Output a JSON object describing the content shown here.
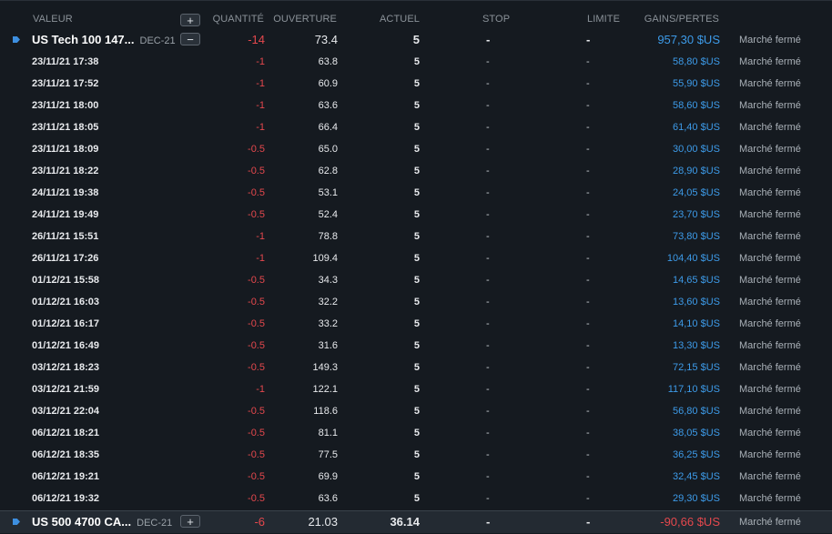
{
  "headers": {
    "valeur": "VALEUR",
    "quantite": "QUANTITÉ",
    "ouverture": "OUVERTURE",
    "actuel": "ACTUEL",
    "stop": "STOP",
    "limite": "LIMITE",
    "gains": "GAINS/PERTES",
    "add_symbol": "+"
  },
  "group1": {
    "name": "US Tech 100 147...",
    "expiry": "DEC-21",
    "toggle": "−",
    "qty": "-14",
    "open": "73.4",
    "current": "5",
    "stop": "-",
    "limit": "-",
    "pl": "957,30 $US",
    "status": "Marché fermé"
  },
  "positions": [
    {
      "date": "23/11/21 17:38",
      "qty": "-1",
      "open": "63.8",
      "current": "5",
      "stop": "-",
      "limit": "-",
      "pl": "58,80 $US",
      "status": "Marché fermé"
    },
    {
      "date": "23/11/21 17:52",
      "qty": "-1",
      "open": "60.9",
      "current": "5",
      "stop": "-",
      "limit": "-",
      "pl": "55,90 $US",
      "status": "Marché fermé"
    },
    {
      "date": "23/11/21 18:00",
      "qty": "-1",
      "open": "63.6",
      "current": "5",
      "stop": "-",
      "limit": "-",
      "pl": "58,60 $US",
      "status": "Marché fermé"
    },
    {
      "date": "23/11/21 18:05",
      "qty": "-1",
      "open": "66.4",
      "current": "5",
      "stop": "-",
      "limit": "-",
      "pl": "61,40 $US",
      "status": "Marché fermé"
    },
    {
      "date": "23/11/21 18:09",
      "qty": "-0.5",
      "open": "65.0",
      "current": "5",
      "stop": "-",
      "limit": "-",
      "pl": "30,00 $US",
      "status": "Marché fermé"
    },
    {
      "date": "23/11/21 18:22",
      "qty": "-0.5",
      "open": "62.8",
      "current": "5",
      "stop": "-",
      "limit": "-",
      "pl": "28,90 $US",
      "status": "Marché fermé"
    },
    {
      "date": "24/11/21 19:38",
      "qty": "-0.5",
      "open": "53.1",
      "current": "5",
      "stop": "-",
      "limit": "-",
      "pl": "24,05 $US",
      "status": "Marché fermé"
    },
    {
      "date": "24/11/21 19:49",
      "qty": "-0.5",
      "open": "52.4",
      "current": "5",
      "stop": "-",
      "limit": "-",
      "pl": "23,70 $US",
      "status": "Marché fermé"
    },
    {
      "date": "26/11/21 15:51",
      "qty": "-1",
      "open": "78.8",
      "current": "5",
      "stop": "-",
      "limit": "-",
      "pl": "73,80 $US",
      "status": "Marché fermé"
    },
    {
      "date": "26/11/21 17:26",
      "qty": "-1",
      "open": "109.4",
      "current": "5",
      "stop": "-",
      "limit": "-",
      "pl": "104,40 $US",
      "status": "Marché fermé"
    },
    {
      "date": "01/12/21 15:58",
      "qty": "-0.5",
      "open": "34.3",
      "current": "5",
      "stop": "-",
      "limit": "-",
      "pl": "14,65 $US",
      "status": "Marché fermé"
    },
    {
      "date": "01/12/21 16:03",
      "qty": "-0.5",
      "open": "32.2",
      "current": "5",
      "stop": "-",
      "limit": "-",
      "pl": "13,60 $US",
      "status": "Marché fermé"
    },
    {
      "date": "01/12/21 16:17",
      "qty": "-0.5",
      "open": "33.2",
      "current": "5",
      "stop": "-",
      "limit": "-",
      "pl": "14,10 $US",
      "status": "Marché fermé"
    },
    {
      "date": "01/12/21 16:49",
      "qty": "-0.5",
      "open": "31.6",
      "current": "5",
      "stop": "-",
      "limit": "-",
      "pl": "13,30 $US",
      "status": "Marché fermé"
    },
    {
      "date": "03/12/21 18:23",
      "qty": "-0.5",
      "open": "149.3",
      "current": "5",
      "stop": "-",
      "limit": "-",
      "pl": "72,15 $US",
      "status": "Marché fermé"
    },
    {
      "date": "03/12/21 21:59",
      "qty": "-1",
      "open": "122.1",
      "current": "5",
      "stop": "-",
      "limit": "-",
      "pl": "117,10 $US",
      "status": "Marché fermé"
    },
    {
      "date": "03/12/21 22:04",
      "qty": "-0.5",
      "open": "118.6",
      "current": "5",
      "stop": "-",
      "limit": "-",
      "pl": "56,80 $US",
      "status": "Marché fermé"
    },
    {
      "date": "06/12/21 18:21",
      "qty": "-0.5",
      "open": "81.1",
      "current": "5",
      "stop": "-",
      "limit": "-",
      "pl": "38,05 $US",
      "status": "Marché fermé"
    },
    {
      "date": "06/12/21 18:35",
      "qty": "-0.5",
      "open": "77.5",
      "current": "5",
      "stop": "-",
      "limit": "-",
      "pl": "36,25 $US",
      "status": "Marché fermé"
    },
    {
      "date": "06/12/21 19:21",
      "qty": "-0.5",
      "open": "69.9",
      "current": "5",
      "stop": "-",
      "limit": "-",
      "pl": "32,45 $US",
      "status": "Marché fermé"
    },
    {
      "date": "06/12/21 19:32",
      "qty": "-0.5",
      "open": "63.6",
      "current": "5",
      "stop": "-",
      "limit": "-",
      "pl": "29,30 $US",
      "status": "Marché fermé"
    }
  ],
  "group2": {
    "name": "US 500 4700 CA...",
    "expiry": "DEC-21",
    "toggle": "+",
    "qty": "-6",
    "open": "21.03",
    "current": "36.14",
    "stop": "-",
    "limit": "-",
    "pl": "-90,66 $US",
    "status": "Marché fermé"
  },
  "colors": {
    "background": "#151a20",
    "negative": "#e5484d",
    "positive": "#3d9be9",
    "tag": "#3d8fe0"
  }
}
